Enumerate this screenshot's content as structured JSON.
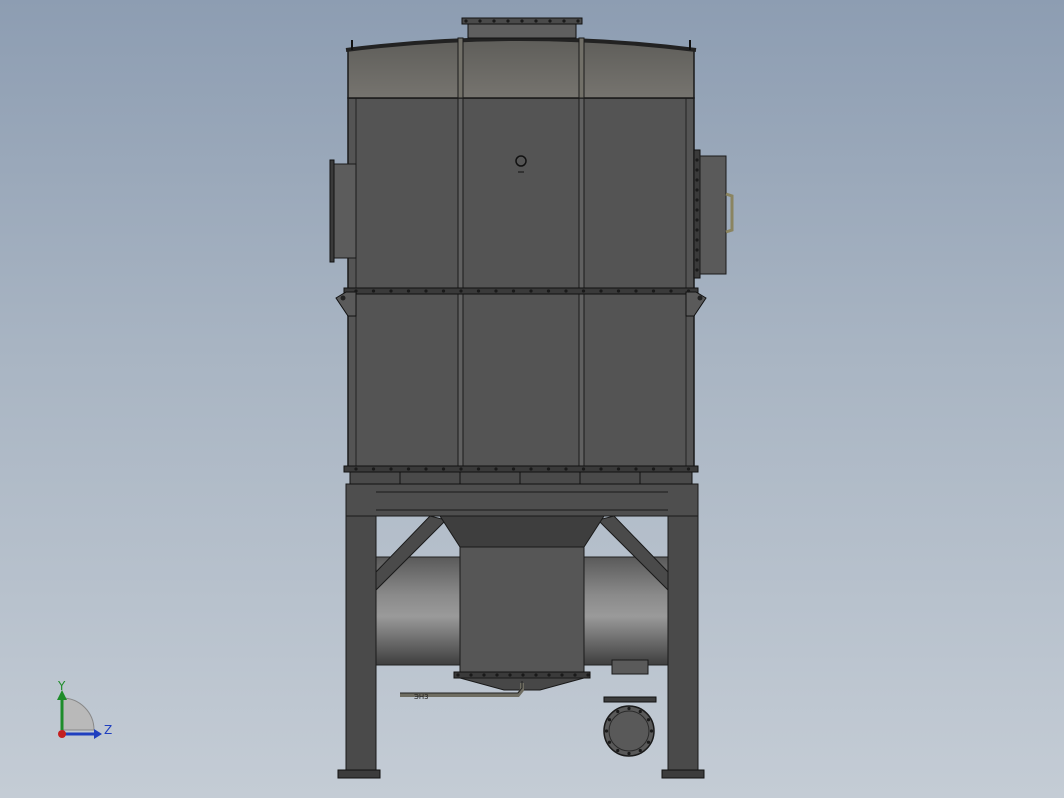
{
  "viewport": {
    "background_top": "#8d9db2",
    "background_bottom": "#c4ccd5"
  },
  "model": {
    "body_color": "#545454",
    "roof_color": "#6e6d69",
    "edge_color": "#1a1a1a",
    "pipe_color": "#6f6d62"
  },
  "triad": {
    "y_label": "Y",
    "z_label": "Z",
    "y_color": "#1e8c2a",
    "z_color": "#1f3fbf",
    "x_color": "#c42020"
  },
  "pipe_tag_text": "ЭН3"
}
